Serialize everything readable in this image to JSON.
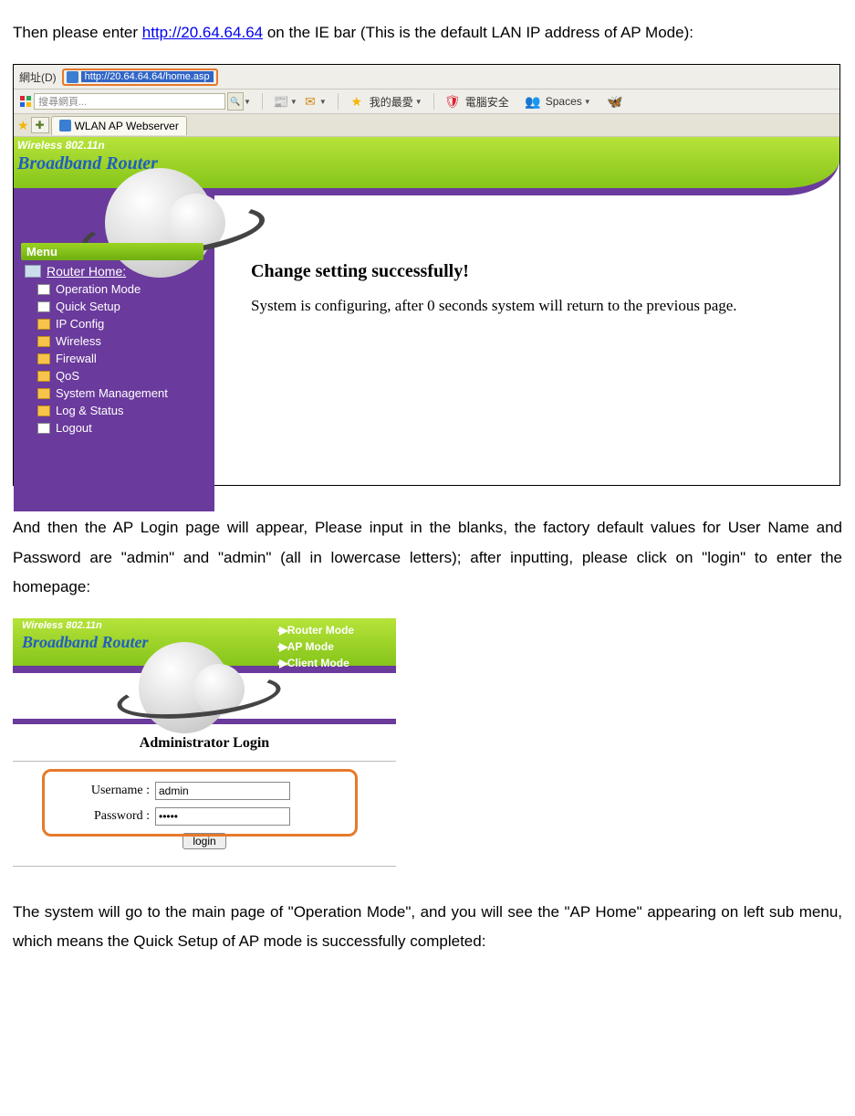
{
  "intro": {
    "text_before_link": "Then please enter ",
    "url": "http://20.64.64.64",
    "text_after_link": " on the IE bar (This is the default LAN IP address of AP Mode):"
  },
  "screenshot1": {
    "address_label": "網址(D)",
    "address_value": "http://20.64.64.64/home.asp",
    "search_placeholder": "搜尋網頁...",
    "toolbar": {
      "favorites": "我的最愛",
      "security": "電腦安全",
      "spaces": "Spaces"
    },
    "tab_title": "WLAN AP Webserver",
    "banner": {
      "wireless": "Wireless 802.11n",
      "router": "Broadband Router"
    },
    "menu": {
      "header": "Menu",
      "root": "Router Home:",
      "items": [
        "Operation Mode",
        "Quick Setup",
        "IP Config",
        "Wireless",
        "Firewall",
        "QoS",
        "System Management",
        "Log & Status",
        "Logout"
      ]
    },
    "content": {
      "heading": "Change setting successfully!",
      "body": "System is configuring, after 0 seconds system will return to the previous page."
    }
  },
  "mid_para": "And then the AP Login page will appear, Please input in the blanks, the factory default values for User Name and Password are \"admin\" and \"admin\" (all in lowercase letters); after inputting, please click on \"login\" to enter the homepage:",
  "screenshot2": {
    "banner": {
      "wireless": "Wireless 802.11n",
      "router": "Broadband Router",
      "modes": [
        "Router Mode",
        "AP Mode",
        "Client Mode"
      ]
    },
    "login_header": "Administrator Login",
    "username_label": "Username :",
    "username_value": "admin",
    "password_label": "Password :",
    "password_value": "•••••",
    "login_button": "login"
  },
  "final_para": "The system will go to the main page of \"Operation Mode\", and you will see the \"AP Home\" appearing on left sub menu, which means the Quick Setup of AP mode is successfully completed:"
}
